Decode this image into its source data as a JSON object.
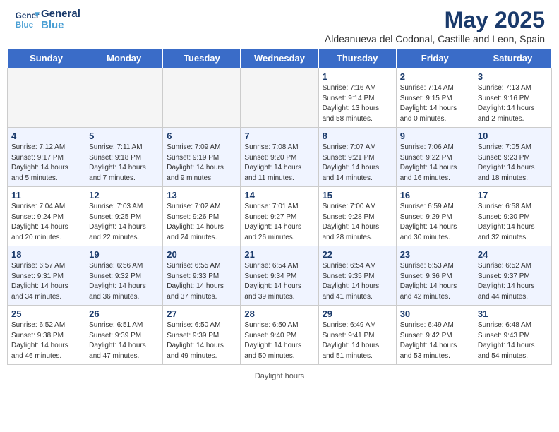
{
  "header": {
    "logo_line1": "General",
    "logo_line2": "Blue",
    "month_title": "May 2025",
    "subtitle": "Aldeanueva del Codonal, Castille and Leon, Spain"
  },
  "days_of_week": [
    "Sunday",
    "Monday",
    "Tuesday",
    "Wednesday",
    "Thursday",
    "Friday",
    "Saturday"
  ],
  "footer": {
    "label": "Daylight hours"
  },
  "weeks": [
    [
      {
        "day": "",
        "info": ""
      },
      {
        "day": "",
        "info": ""
      },
      {
        "day": "",
        "info": ""
      },
      {
        "day": "",
        "info": ""
      },
      {
        "day": "1",
        "info": "Sunrise: 7:16 AM\nSunset: 9:14 PM\nDaylight: 13 hours\nand 58 minutes."
      },
      {
        "day": "2",
        "info": "Sunrise: 7:14 AM\nSunset: 9:15 PM\nDaylight: 14 hours\nand 0 minutes."
      },
      {
        "day": "3",
        "info": "Sunrise: 7:13 AM\nSunset: 9:16 PM\nDaylight: 14 hours\nand 2 minutes."
      }
    ],
    [
      {
        "day": "4",
        "info": "Sunrise: 7:12 AM\nSunset: 9:17 PM\nDaylight: 14 hours\nand 5 minutes."
      },
      {
        "day": "5",
        "info": "Sunrise: 7:11 AM\nSunset: 9:18 PM\nDaylight: 14 hours\nand 7 minutes."
      },
      {
        "day": "6",
        "info": "Sunrise: 7:09 AM\nSunset: 9:19 PM\nDaylight: 14 hours\nand 9 minutes."
      },
      {
        "day": "7",
        "info": "Sunrise: 7:08 AM\nSunset: 9:20 PM\nDaylight: 14 hours\nand 11 minutes."
      },
      {
        "day": "8",
        "info": "Sunrise: 7:07 AM\nSunset: 9:21 PM\nDaylight: 14 hours\nand 14 minutes."
      },
      {
        "day": "9",
        "info": "Sunrise: 7:06 AM\nSunset: 9:22 PM\nDaylight: 14 hours\nand 16 minutes."
      },
      {
        "day": "10",
        "info": "Sunrise: 7:05 AM\nSunset: 9:23 PM\nDaylight: 14 hours\nand 18 minutes."
      }
    ],
    [
      {
        "day": "11",
        "info": "Sunrise: 7:04 AM\nSunset: 9:24 PM\nDaylight: 14 hours\nand 20 minutes."
      },
      {
        "day": "12",
        "info": "Sunrise: 7:03 AM\nSunset: 9:25 PM\nDaylight: 14 hours\nand 22 minutes."
      },
      {
        "day": "13",
        "info": "Sunrise: 7:02 AM\nSunset: 9:26 PM\nDaylight: 14 hours\nand 24 minutes."
      },
      {
        "day": "14",
        "info": "Sunrise: 7:01 AM\nSunset: 9:27 PM\nDaylight: 14 hours\nand 26 minutes."
      },
      {
        "day": "15",
        "info": "Sunrise: 7:00 AM\nSunset: 9:28 PM\nDaylight: 14 hours\nand 28 minutes."
      },
      {
        "day": "16",
        "info": "Sunrise: 6:59 AM\nSunset: 9:29 PM\nDaylight: 14 hours\nand 30 minutes."
      },
      {
        "day": "17",
        "info": "Sunrise: 6:58 AM\nSunset: 9:30 PM\nDaylight: 14 hours\nand 32 minutes."
      }
    ],
    [
      {
        "day": "18",
        "info": "Sunrise: 6:57 AM\nSunset: 9:31 PM\nDaylight: 14 hours\nand 34 minutes."
      },
      {
        "day": "19",
        "info": "Sunrise: 6:56 AM\nSunset: 9:32 PM\nDaylight: 14 hours\nand 36 minutes."
      },
      {
        "day": "20",
        "info": "Sunrise: 6:55 AM\nSunset: 9:33 PM\nDaylight: 14 hours\nand 37 minutes."
      },
      {
        "day": "21",
        "info": "Sunrise: 6:54 AM\nSunset: 9:34 PM\nDaylight: 14 hours\nand 39 minutes."
      },
      {
        "day": "22",
        "info": "Sunrise: 6:54 AM\nSunset: 9:35 PM\nDaylight: 14 hours\nand 41 minutes."
      },
      {
        "day": "23",
        "info": "Sunrise: 6:53 AM\nSunset: 9:36 PM\nDaylight: 14 hours\nand 42 minutes."
      },
      {
        "day": "24",
        "info": "Sunrise: 6:52 AM\nSunset: 9:37 PM\nDaylight: 14 hours\nand 44 minutes."
      }
    ],
    [
      {
        "day": "25",
        "info": "Sunrise: 6:52 AM\nSunset: 9:38 PM\nDaylight: 14 hours\nand 46 minutes."
      },
      {
        "day": "26",
        "info": "Sunrise: 6:51 AM\nSunset: 9:39 PM\nDaylight: 14 hours\nand 47 minutes."
      },
      {
        "day": "27",
        "info": "Sunrise: 6:50 AM\nSunset: 9:39 PM\nDaylight: 14 hours\nand 49 minutes."
      },
      {
        "day": "28",
        "info": "Sunrise: 6:50 AM\nSunset: 9:40 PM\nDaylight: 14 hours\nand 50 minutes."
      },
      {
        "day": "29",
        "info": "Sunrise: 6:49 AM\nSunset: 9:41 PM\nDaylight: 14 hours\nand 51 minutes."
      },
      {
        "day": "30",
        "info": "Sunrise: 6:49 AM\nSunset: 9:42 PM\nDaylight: 14 hours\nand 53 minutes."
      },
      {
        "day": "31",
        "info": "Sunrise: 6:48 AM\nSunset: 9:43 PM\nDaylight: 14 hours\nand 54 minutes."
      }
    ]
  ]
}
